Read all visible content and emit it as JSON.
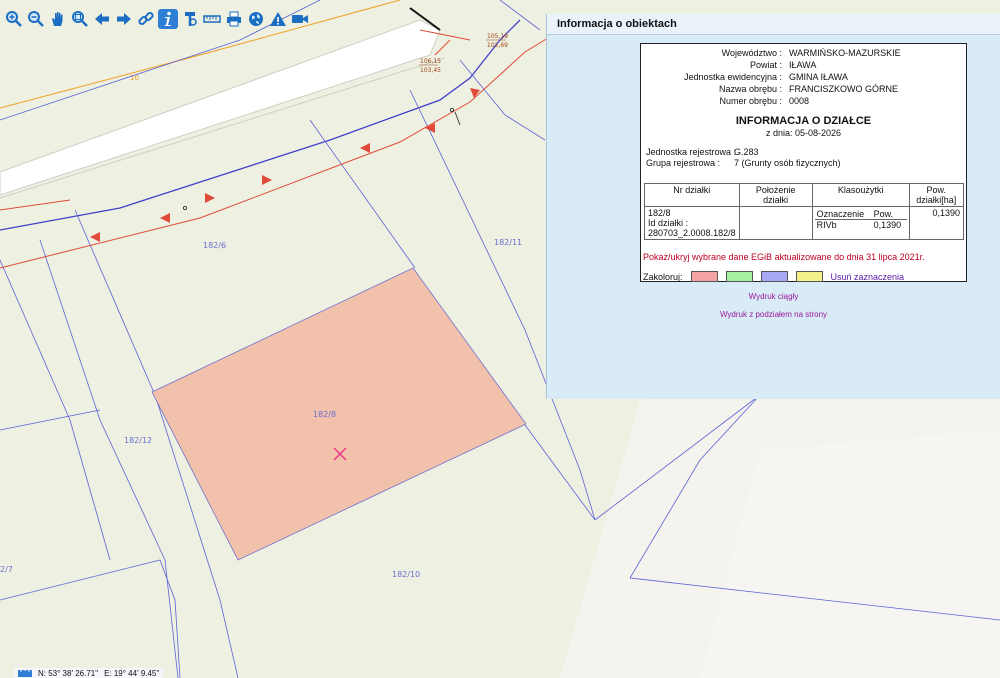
{
  "toolbar": {
    "tools": [
      {
        "name": "zoom-in"
      },
      {
        "name": "zoom-out"
      },
      {
        "name": "pan"
      },
      {
        "name": "zoom-window"
      },
      {
        "name": "back"
      },
      {
        "name": "forward"
      },
      {
        "name": "link"
      },
      {
        "name": "info",
        "active": true
      },
      {
        "name": "parcel-info"
      },
      {
        "name": "measure"
      },
      {
        "name": "print"
      },
      {
        "name": "globe"
      },
      {
        "name": "warning"
      },
      {
        "name": "camera"
      }
    ]
  },
  "map": {
    "parcel_labels": [
      "182/6",
      "182/11",
      "182/12",
      "182/8",
      "182/10",
      "2/7"
    ],
    "elevation_labels": [
      "105,19",
      "102,69",
      "106,15",
      "103,45"
    ],
    "utility_label": "10",
    "selected_fill": "#f2c1ab",
    "line_color_parcel": "#5b62d6",
    "line_color_utility": "#e04a3a",
    "line_color_gas": "#f0a020"
  },
  "panel": {
    "title": "Informacja o obiektach",
    "fields": [
      {
        "label": "Województwo :",
        "value": "WARMIŃSKO-MAZURSKIE"
      },
      {
        "label": "Powiat :",
        "value": "IŁAWA"
      },
      {
        "label": "Jednostka ewidencyjna :",
        "value": "GMINA IŁAWA"
      },
      {
        "label": "Nazwa obrębu :",
        "value": "FRANCISZKOWO GÓRNE"
      },
      {
        "label": "Numer obrębu :",
        "value": "0008"
      }
    ],
    "heading": "INFORMACJA O DZIAŁCE",
    "date": "z dnia: 05-08-2026",
    "registry_unit_label": "Jednostka rejestrowa :",
    "registry_unit_value": "G.283",
    "registry_group_label": "Grupa rejestrowa :",
    "registry_group_value": "7 (Grunty osób fizycznych)",
    "table": {
      "headers": [
        "Nr działki",
        "Położenie działki",
        "Klasoużytki",
        "Pow. działki[ha]"
      ],
      "sub_headers": [
        "Oznaczenie",
        "Pow."
      ],
      "parcel_no": "182/8",
      "parcel_id_label": "Id działki :",
      "parcel_id": "280703_2.0008.182/8",
      "class_code": "RIVb",
      "class_area": "0,1390",
      "area": "0,1390"
    },
    "notice": "Pokaż/ukryj wybrane dane EGiB aktualizowane do dnia 31 lipca 2021r.",
    "colorize_label": "Zakoloruj:",
    "swatch_colors": [
      "#f4a3a3",
      "#a3f0a3",
      "#a8a8f4",
      "#f4f08c"
    ],
    "clear_selection": "Usuń zaznaczenia",
    "print_continuous": "Wydruk ciągły",
    "print_pages": "Wydruk z podziałem na strony"
  },
  "status": {
    "toggle": "* \" *",
    "north": "N: 53° 38' 26.71\"",
    "east": "E: 19° 44' 9.45\""
  }
}
